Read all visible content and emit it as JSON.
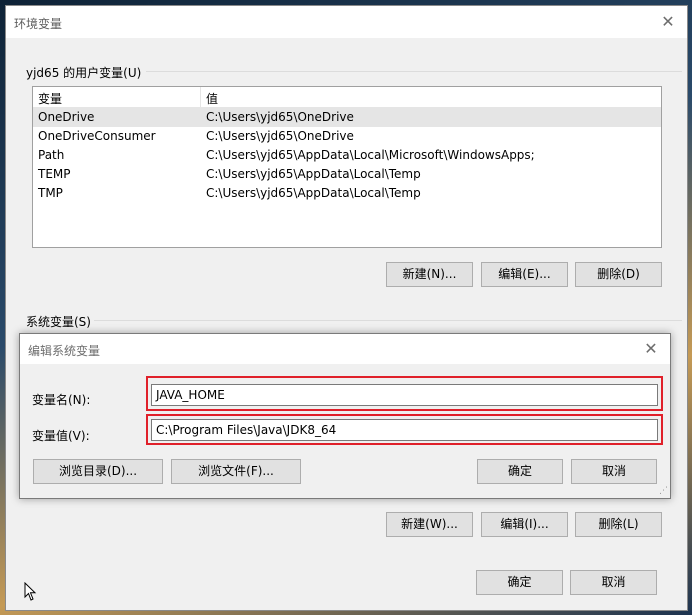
{
  "main_dialog": {
    "title": "环境变量",
    "user_group_label": "yjd65 的用户变量(U)",
    "user_vars": {
      "headers": [
        "变量",
        "值"
      ],
      "rows": [
        {
          "name": "OneDrive",
          "value": "C:\\Users\\yjd65\\OneDrive"
        },
        {
          "name": "OneDriveConsumer",
          "value": "C:\\Users\\yjd65\\OneDrive"
        },
        {
          "name": "Path",
          "value": "C:\\Users\\yjd65\\AppData\\Local\\Microsoft\\WindowsApps;"
        },
        {
          "name": "TEMP",
          "value": "C:\\Users\\yjd65\\AppData\\Local\\Temp"
        },
        {
          "name": "TMP",
          "value": "C:\\Users\\yjd65\\AppData\\Local\\Temp"
        }
      ]
    },
    "user_buttons": {
      "new": "新建(N)...",
      "edit": "编辑(E)...",
      "delete": "删除(D)"
    },
    "system_group_label": "系统变量(S)",
    "system_buttons": {
      "new": "新建(W)...",
      "edit": "编辑(I)...",
      "delete": "删除(L)"
    },
    "ok": "确定",
    "cancel": "取消"
  },
  "edit_dialog": {
    "title": "编辑系统变量",
    "name_label": "变量名(N):",
    "name_value": "JAVA_HOME",
    "value_label": "变量值(V):",
    "value_value": "C:\\Program Files\\Java\\JDK8_64",
    "browse_dir": "浏览目录(D)...",
    "browse_file": "浏览文件(F)...",
    "ok": "确定",
    "cancel": "取消"
  },
  "colors": {
    "highlight": "#e0202a",
    "selected_row": "#e5e5e5"
  }
}
